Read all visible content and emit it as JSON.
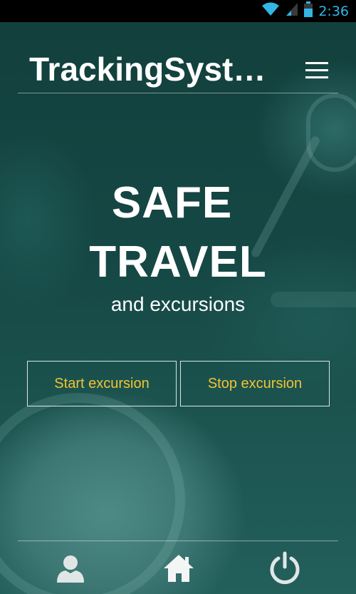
{
  "status_bar": {
    "time": "2:36",
    "icons": [
      "wifi-icon",
      "signal-icon",
      "battery-icon"
    ],
    "time_color": "#33b5e5"
  },
  "header": {
    "title": "TrackingSystem",
    "menu_icon": "hamburger-menu-icon"
  },
  "hero": {
    "line1": "SAFE",
    "line2": "TRAVEL",
    "subtitle": "and excursions"
  },
  "actions": {
    "start_label": "Start excursion",
    "stop_label": "Stop excursion",
    "label_color": "#f2c433"
  },
  "bottom_nav": {
    "items": [
      {
        "icon": "user-icon"
      },
      {
        "icon": "home-icon"
      },
      {
        "icon": "power-icon"
      }
    ]
  },
  "theme": {
    "background": "#154744",
    "icon_color": "#e8ecec"
  }
}
